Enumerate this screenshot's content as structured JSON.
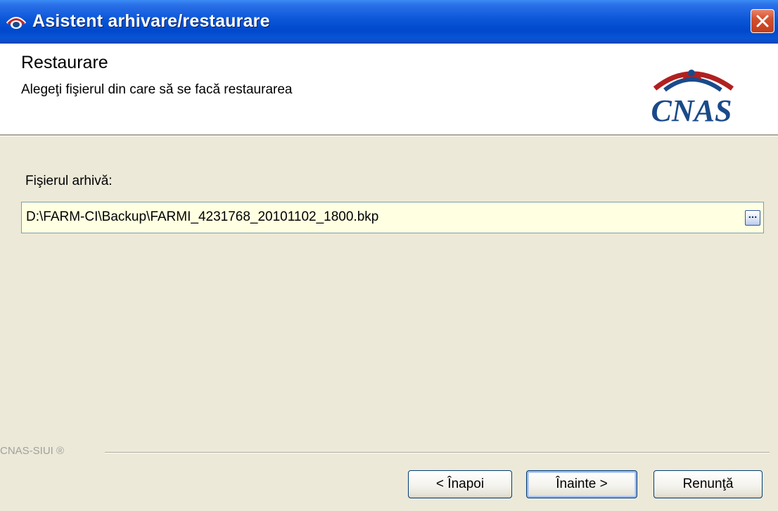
{
  "window": {
    "title": "Asistent arhivare/restaurare",
    "close_label": "×"
  },
  "header": {
    "title": "Restaurare",
    "subtitle": "Alegeţi fişierul din care să se facă restaurarea",
    "logo_text": "CNAS"
  },
  "form": {
    "file_label": "Fişierul arhivă:",
    "file_path": "D:\\FARM-CI\\Backup\\FARMI_4231768_20101102_1800.bkp",
    "browse_label": "..."
  },
  "footer": {
    "brand": "CNAS-SIUI ®"
  },
  "buttons": {
    "back": "< Înapoi",
    "next": "Înainte >",
    "cancel": "Renunţă"
  },
  "colors": {
    "titlebar": "#0a56d8",
    "dialog_bg": "#ece9d8",
    "field_bg": "#ffffe1",
    "logo_blue": "#1a4a8a",
    "logo_red": "#b02020"
  },
  "icons": {
    "app": "cnas-app-icon",
    "close": "close-icon",
    "browse": "browse-ellipsis-icon"
  }
}
